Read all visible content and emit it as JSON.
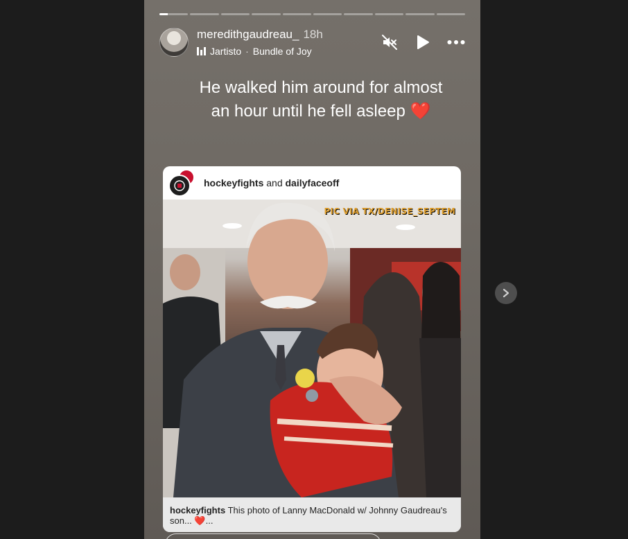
{
  "story": {
    "segments": 10,
    "active_segment_progress": 0.3,
    "username": "meredithgaudreau_",
    "time": "18h",
    "music": {
      "artist": "Jartisto",
      "separator": "·",
      "track": "Bundle of Joy"
    },
    "caption_line1": "He walked him around for almost",
    "caption_line2": "an hour until he fell asleep",
    "caption_emoji": "❤️",
    "controls": [
      "mute-icon",
      "play-icon",
      "more-icon"
    ]
  },
  "post": {
    "author1": "hockeyfights",
    "connector": "and",
    "author2": "dailyfaceoff",
    "watermark": "PIC VIA TX/DENISE_SEPTEM",
    "caption_author": "hockeyfights",
    "caption_text": "This photo of Lanny MacDonald w/ Johnny Gaudreau's son... ",
    "caption_emoji": "❤️",
    "caption_ellipsis": "..."
  },
  "colors": {
    "page_bg": "#1c1c1c",
    "story_bg": "#6e6963",
    "heart": "#e0245e",
    "watermark": "#e0a030"
  }
}
